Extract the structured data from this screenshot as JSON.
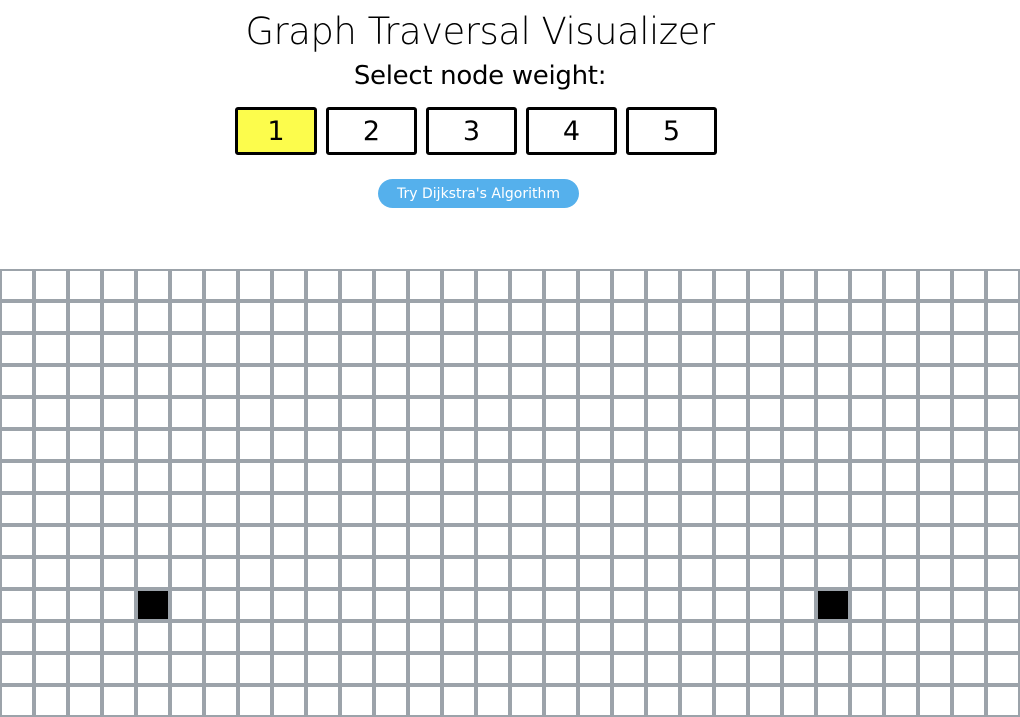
{
  "header": {
    "title": "Graph Traversal Visualizer",
    "subtitle": "Select node weight:"
  },
  "weights": {
    "options": [
      "1",
      "2",
      "3",
      "4",
      "5"
    ],
    "selected": "1",
    "selected_color": "#fcfc4c"
  },
  "algorithm_button": {
    "label": "Try Dijkstra's Algorithm",
    "color": "#55b0ec"
  },
  "grid": {
    "columns": 30,
    "rows": 14,
    "line_color": "#9ca3aa",
    "filled_color": "#000000",
    "filled_cells": [
      {
        "row": 10,
        "col": 4
      },
      {
        "row": 10,
        "col": 24
      }
    ]
  }
}
